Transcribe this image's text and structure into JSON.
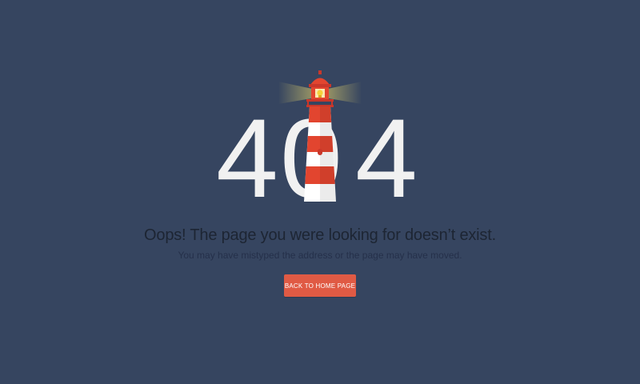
{
  "error": {
    "code_first_digit": "4",
    "code_middle_digit": "0",
    "code_last_digit": "4"
  },
  "message": {
    "headline": "Oops! The page you were looking for doesn’t exist.",
    "subline": "You may have mistyped the address or the page may have moved."
  },
  "actions": {
    "home_button_label": "BACK TO HOME PAGE"
  },
  "colors": {
    "background": "#364560",
    "digits": "#f1f1f1",
    "lighthouse_red": "#e2452f",
    "lighthouse_white": "#ffffff",
    "lamp_yellow": "#f5d23a",
    "button": "#e05a44"
  },
  "illustration": {
    "icon": "lighthouse-icon"
  }
}
